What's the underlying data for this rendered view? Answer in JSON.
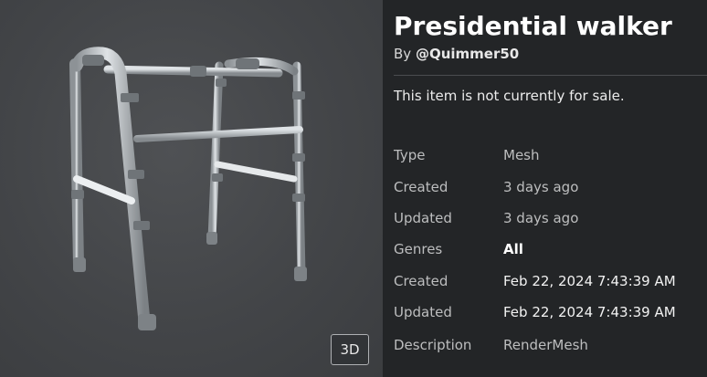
{
  "viewer": {
    "button_3d": "3D",
    "model_icon": "walker-model-preview"
  },
  "item": {
    "title": "Presidential walker",
    "by_prefix": "By",
    "creator": "@Quimmer50",
    "sale_status": "This item is not currently for sale."
  },
  "details": [
    {
      "label": "Type",
      "value": "Mesh"
    },
    {
      "label": "Created",
      "value": "3 days ago"
    },
    {
      "label": "Updated",
      "value": "3 days ago"
    },
    {
      "label": "Genres",
      "value": "All"
    },
    {
      "label": "Created",
      "value": "Feb 22, 2024 7:43:39 AM"
    },
    {
      "label": "Updated",
      "value": "Feb 22, 2024 7:43:39 AM"
    },
    {
      "label": "Description",
      "value": "RenderMesh"
    }
  ],
  "colors": {
    "panel_bg": "#232527",
    "viewer_bg": "#47494c",
    "text_primary": "#ffffff",
    "text_muted": "#bdbebf"
  }
}
